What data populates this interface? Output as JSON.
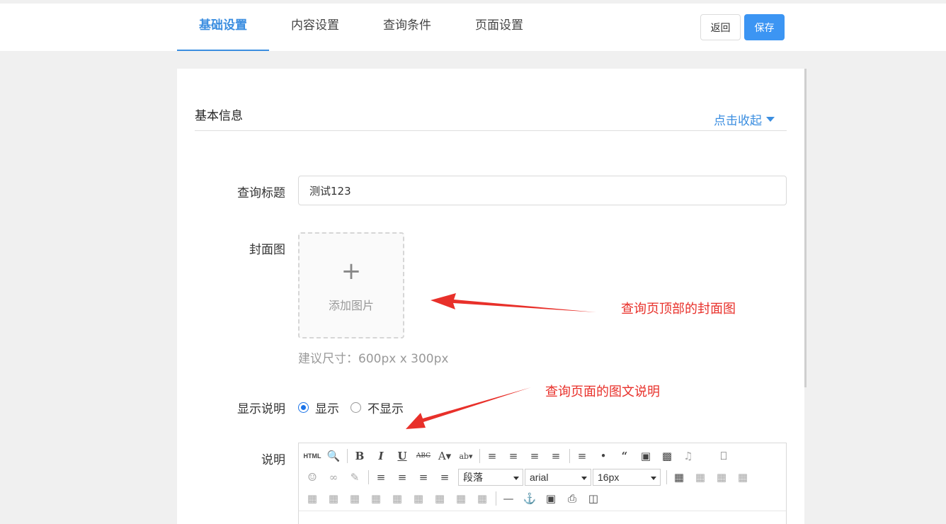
{
  "tabs": [
    {
      "label": "基础设置",
      "active": true
    },
    {
      "label": "内容设置",
      "active": false
    },
    {
      "label": "查询条件",
      "active": false
    },
    {
      "label": "页面设置",
      "active": false
    }
  ],
  "actions": {
    "back_label": "返回",
    "save_label": "保存"
  },
  "section": {
    "title": "基本信息",
    "collapse_label": "点击收起"
  },
  "form": {
    "query_title_label": "查询标题",
    "query_title_value": "测试123",
    "cover_label": "封面图",
    "cover_upload_plus": "+",
    "cover_upload_text": "添加图片",
    "cover_hint": "建议尺寸：600px x 300px",
    "show_desc_label": "显示说明",
    "show_option": "显示",
    "hide_option": "不显示",
    "desc_label": "说明"
  },
  "editor": {
    "paragraph_select": "段落",
    "font_select": "arial",
    "size_select": "16px",
    "html_button": "HTML"
  },
  "annotations": {
    "cover_note": "查询页顶部的封面图",
    "desc_note": "查询页面的图文说明"
  },
  "colors": {
    "accent": "#3b8ee0",
    "save_button": "#3c95f3",
    "annotation": "#e8302a"
  }
}
